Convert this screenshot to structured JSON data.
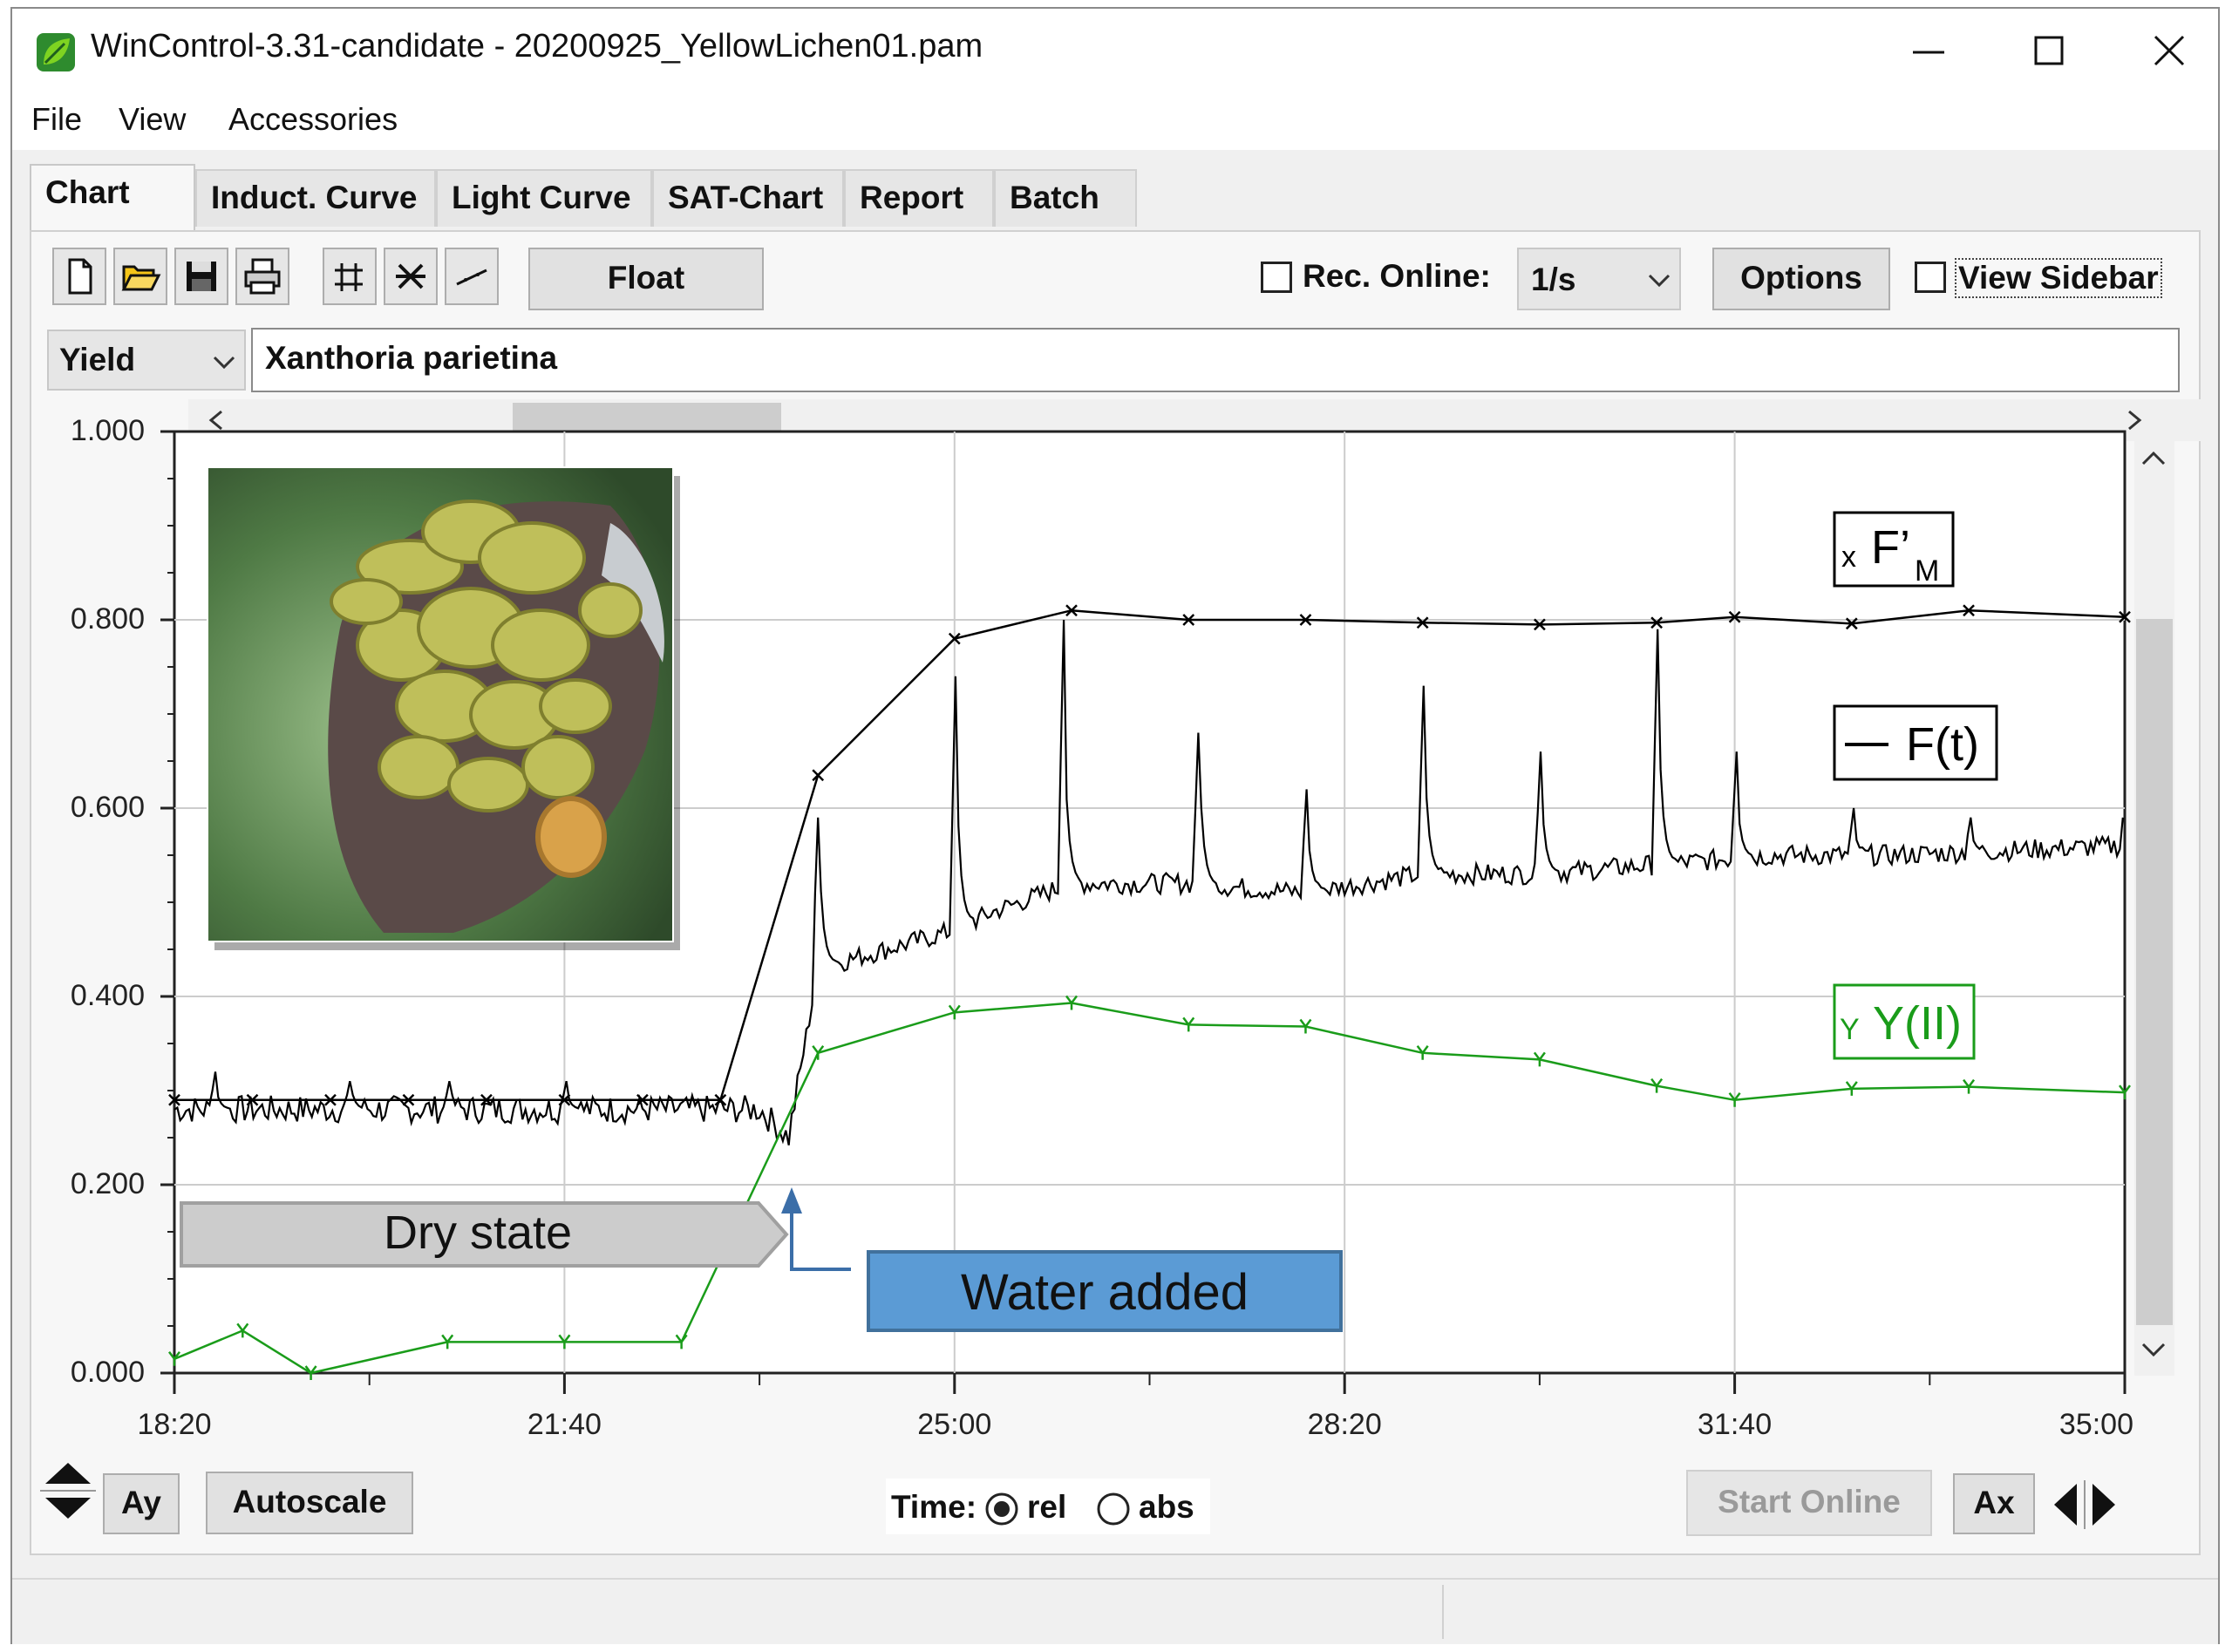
{
  "window": {
    "title": "WinControl-3.31-candidate - 20200925_YellowLichen01.pam",
    "minimize_glyph": "—",
    "maximize_glyph": "☐",
    "close_glyph": "✕"
  },
  "menu": [
    "File",
    "View",
    "Accessories"
  ],
  "tabs": [
    "Chart",
    "Induct. Curve",
    "Light Curve",
    "SAT-Chart",
    "Report",
    "Batch"
  ],
  "toolbar": {
    "float_label": "Float",
    "rec_online_label": "Rec. Online:",
    "rec_online_checked": false,
    "rate_value": "1/s",
    "options_label": "Options",
    "view_sidebar_label": "View Sidebar",
    "view_sidebar_checked": false
  },
  "param_row": {
    "param_value": "Yield",
    "sample_name": "Xanthoria parietina"
  },
  "annotations": {
    "dry_state": "Dry state",
    "water_added": "Water added"
  },
  "legend": {
    "fm_marker": "x",
    "fm_label": "F’",
    "fm_sub": "M",
    "ft_label": "F(t)",
    "y_marker": "Y",
    "y_label": "Y(II)"
  },
  "bottom": {
    "ay_label": "Ay",
    "autoscale_label": "Autoscale",
    "time_label": "Time:",
    "rel_label": "rel",
    "abs_label": "abs",
    "time_mode": "rel",
    "start_online_label": "Start Online",
    "ax_label": "Ax"
  },
  "colors": {
    "fm_series": "#000000",
    "ft_series": "#000000",
    "y_series": "#1a9c1a",
    "water_box": "#5b9bd5",
    "dry_box": "#cccccc",
    "grid": "#cccccc"
  },
  "chart_data": {
    "type": "line",
    "x_unit": "min:sec (relative time)",
    "xlim_seconds": [
      1100,
      2100
    ],
    "ylim": [
      0,
      1
    ],
    "x_ticks": [
      "18:20",
      "21:40",
      "25:00",
      "28:20",
      "31:40",
      "35:00"
    ],
    "y_ticks": [
      "0.000",
      "0.200",
      "0.400",
      "0.600",
      "0.800",
      "1.000"
    ],
    "grid": true,
    "legend": "right, inside plot",
    "series": [
      {
        "name": "F’M",
        "marker": "x",
        "points": [
          [
            "18:20",
            0.29
          ],
          [
            "19:00",
            0.29
          ],
          [
            "19:40",
            0.29
          ],
          [
            "20:20",
            0.29
          ],
          [
            "21:00",
            0.29
          ],
          [
            "21:40",
            0.29
          ],
          [
            "22:20",
            0.29
          ],
          [
            "23:00",
            0.29
          ],
          [
            "23:50",
            0.635
          ],
          [
            "25:00",
            0.78
          ],
          [
            "26:00",
            0.81
          ],
          [
            "27:00",
            0.8
          ],
          [
            "28:00",
            0.8
          ],
          [
            "29:00",
            0.797
          ],
          [
            "30:00",
            0.795
          ],
          [
            "31:00",
            0.797
          ],
          [
            "31:40",
            0.803
          ],
          [
            "32:40",
            0.796
          ],
          [
            "33:40",
            0.81
          ],
          [
            "35:00",
            0.803
          ]
        ]
      },
      {
        "name": "F(t)",
        "marker": "none",
        "baseline": [
          [
            "18:20",
            0.28
          ],
          [
            "23:20",
            0.28
          ],
          [
            "23:35",
            0.25
          ],
          [
            "23:50",
            0.43
          ],
          [
            "25:00",
            0.47
          ],
          [
            "25:20",
            0.49
          ],
          [
            "26:00",
            0.52
          ],
          [
            "27:00",
            0.52
          ],
          [
            "28:00",
            0.51
          ],
          [
            "29:00",
            0.53
          ],
          [
            "30:00",
            0.53
          ],
          [
            "31:00",
            0.54
          ],
          [
            "32:00",
            0.55
          ],
          [
            "33:00",
            0.55
          ],
          [
            "35:00",
            0.56
          ]
        ],
        "peaks": [
          [
            "18:40",
            0.32
          ],
          [
            "19:50",
            0.31
          ],
          [
            "20:40",
            0.31
          ],
          [
            "21:40",
            0.31
          ],
          [
            "23:50",
            0.59
          ],
          [
            "25:00",
            0.74
          ],
          [
            "25:55",
            0.8
          ],
          [
            "27:05",
            0.68
          ],
          [
            "28:00",
            0.62
          ],
          [
            "29:00",
            0.73
          ],
          [
            "30:00",
            0.66
          ],
          [
            "31:00",
            0.79
          ],
          [
            "31:40",
            0.66
          ],
          [
            "32:40",
            0.6
          ],
          [
            "33:40",
            0.59
          ],
          [
            "35:00",
            0.62
          ]
        ]
      },
      {
        "name": "Y(II)",
        "marker": "Y",
        "points": [
          [
            "18:20",
            0.015
          ],
          [
            "18:55",
            0.045
          ],
          [
            "19:30",
            0.0
          ],
          [
            "20:40",
            0.033
          ],
          [
            "21:40",
            0.033
          ],
          [
            "22:40",
            0.033
          ],
          [
            "23:50",
            0.34
          ],
          [
            "25:00",
            0.383
          ],
          [
            "26:00",
            0.393
          ],
          [
            "27:00",
            0.37
          ],
          [
            "28:00",
            0.368
          ],
          [
            "29:00",
            0.34
          ],
          [
            "30:00",
            0.333
          ],
          [
            "31:00",
            0.305
          ],
          [
            "31:40",
            0.29
          ],
          [
            "32:40",
            0.302
          ],
          [
            "33:40",
            0.304
          ],
          [
            "35:00",
            0.298
          ]
        ]
      }
    ]
  }
}
